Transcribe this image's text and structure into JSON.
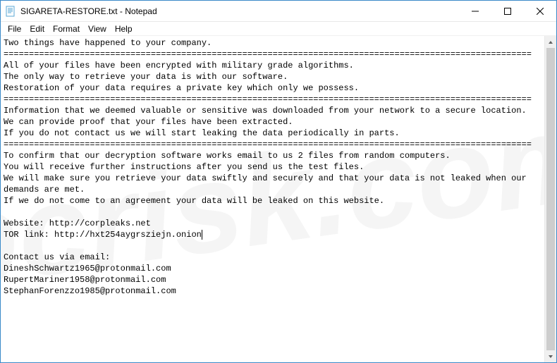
{
  "window": {
    "title": "SIGARETA-RESTORE.txt - Notepad"
  },
  "menu": {
    "file": "File",
    "edit": "Edit",
    "format": "Format",
    "view": "View",
    "help": "Help"
  },
  "document": {
    "body_pre": "Two things have happened to your company.\n========================================================================================================\nAll of your files have been encrypted with military grade algorithms.\nThe only way to retrieve your data is with our software.\nRestoration of your data requires a private key which only we possess.\n========================================================================================================\nInformation that we deemed valuable or sensitive was downloaded from your network to a secure location.\nWe can provide proof that your files have been extracted.\nIf you do not contact us we will start leaking the data periodically in parts.\n========================================================================================================\nTo confirm that our decryption software works email to us 2 files from random computers.\nYou will receive further instructions after you send us the test files.\nWe will make sure you retrieve your data swiftly and securely and that your data is not leaked when our demands are met.\nIf we do not come to an agreement your data will be leaked on this website.\n\nWebsite: http://corpleaks.net\nTOR link: http://hxt254aygrsziejn.onion",
    "body_post": "\n\nContact us via email:\nDineshSchwartz1965@protonmail.com\nRupertMariner1958@protonmail.com\nStephanForenzzo1985@protonmail.com"
  },
  "watermark": "pcrisk.com"
}
